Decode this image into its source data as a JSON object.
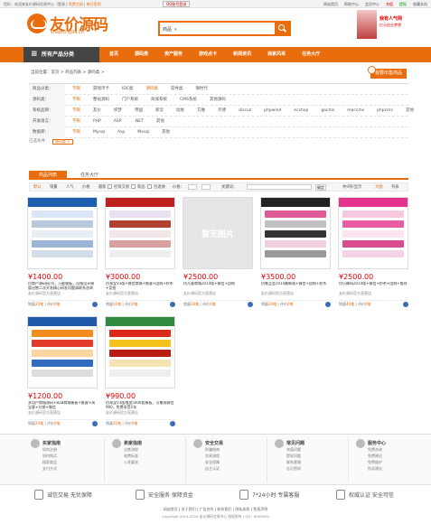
{
  "topbar": {
    "welcome": "您好，欢迎来友价源码交易中心（登录",
    "register": "免费注册",
    "sign": "每日签到",
    "qq": "QQ账号登录",
    "right": [
      "网站首页",
      "帮助中心",
      "会员中心",
      "充值",
      "提现",
      "收藏本站"
    ]
  },
  "logo": {
    "name": "友价源码",
    "domain": "shopt5.yj99.cn"
  },
  "search": {
    "category": "商品",
    "placeholder": ""
  },
  "ad": {
    "t1": "我有人气网",
    "t2": "亿元创业梦想"
  },
  "nav": {
    "allcat": "所有产品分类",
    "links": [
      "首页",
      "源码类",
      "资产服务",
      "游戏点卡",
      "新闻资讯",
      "商家风采",
      "任务大厅"
    ]
  },
  "crumb": "当前位置：首页 > 商品列表 > 源码类 >",
  "post_button": "我要出售商品",
  "filters": [
    {
      "label": "商品分类：",
      "options": [
        "不限",
        "游戏币卡",
        "IDC类",
        "源码类",
        "软件类",
        "微时代"
      ],
      "active": 3
    },
    {
      "label": "源码类：",
      "options": [
        "不限",
        "整站源码",
        "门户系统",
        "商城系统",
        "CMS系统",
        "其他源码"
      ],
      "active": 0
    },
    {
      "label": "系统品牌：",
      "options": [
        "不限",
        "友价",
        "织梦",
        "帝国",
        "新云",
        "动易",
        "方维",
        "齐博",
        "discuz",
        "phpwind",
        "ecshop",
        "gacms",
        "maccms",
        "phpcms",
        "其他"
      ],
      "active": 0
    },
    {
      "label": "开发语言：",
      "options": [
        "不限",
        "PHP",
        "ASP",
        ".NET",
        "其他"
      ],
      "active": 0
    },
    {
      "label": "数据库：",
      "options": [
        "不限",
        "Mysql",
        "Asp",
        "Mssql",
        "其他"
      ],
      "active": 0
    }
  ],
  "selected": {
    "label": "已选条件：",
    "tag": "源码类 ×"
  },
  "tabs": [
    "商品列表",
    "任务大厅"
  ],
  "sortbar": {
    "items": [
      "默认",
      "销量",
      "人气",
      "价格",
      "最新"
    ],
    "opts": [
      "担保交易",
      "新品",
      "包退换",
      "价格："
    ],
    "keyword": "关键词：",
    "ok": "确定",
    "pages": "共9项/显示",
    "view": "大图",
    "list": "列表"
  },
  "products": [
    {
      "price": "¥1400.00",
      "title": "仿商户源码网76，万能模板，风格设计模版出售二次开发精心研发问题请联系咨询",
      "shop": "友价源码官方直营店",
      "sales": "销量",
      "sales_n": "20笔",
      "reviews": "评价",
      "reviews_n": "0笔",
      "img": "blue"
    },
    {
      "price": "¥3000.00",
      "title": "仿淘宝V3版+微信商城+推客+团购+秒杀+竞拍",
      "shop": "友价源码官方直营店",
      "sales": "销量",
      "sales_n": "20笔",
      "reviews": "评价",
      "reviews_n": "0笔",
      "img": "v3"
    },
    {
      "price": "¥2500.00",
      "title": "仿凡客商城2014版+微信+团购",
      "shop": "友价源码官方直营店",
      "sales": "销量",
      "sales_n": "20笔",
      "reviews": "评价",
      "reviews_n": "0笔",
      "img": "none",
      "noimg": "暂无图片"
    },
    {
      "price": "¥3500.00",
      "title": "仿唯品会2014最新版+微信+团购+秒杀",
      "shop": "友价源码官方直营店",
      "sales": "销量",
      "sales_n": "20笔",
      "reviews": "评价",
      "reviews_n": "0笔",
      "img": "dark"
    },
    {
      "price": "¥2500.00",
      "title": "仿乐蜂网2014版+微信+秒杀+团购+推荐",
      "shop": "友价源码官方直营店",
      "sales": "销量",
      "sales_n": "40笔",
      "reviews": "评价",
      "reviews_n": "0笔",
      "img": "pink"
    },
    {
      "price": "¥1200.00",
      "title": "多用户商城源码+B2B商城模板+推客+淘宝客+分销+微信",
      "shop": "友价源码官方直营店",
      "sales": "销量",
      "sales_n": "20笔",
      "reviews": "评价",
      "reviews_n": "0笔",
      "img": "orange"
    },
    {
      "price": "¥990.00",
      "title": "仿淘宝V3版增加5000套模板，可集成微信990，免费享受1年",
      "shop": "友价源码官方直营店",
      "sales": "销量",
      "sales_n": "20笔",
      "reviews": "评价",
      "reviews_n": "0笔",
      "img": "red"
    }
  ],
  "help": [
    {
      "title": "买家指南",
      "links": [
        "如何注册",
        "如何购买",
        "搜索商品",
        "支付方式"
      ]
    },
    {
      "title": "卖家指南",
      "links": [
        "出售流程",
        "收费标准",
        "入驻要求"
      ]
    },
    {
      "title": "安全交易",
      "links": [
        "防骗指南",
        "交易流程",
        "安全保障",
        "店主认证"
      ]
    },
    {
      "title": "常见问题",
      "links": [
        "充值问题",
        "提现问题",
        "联系客服",
        "忘记密码"
      ]
    },
    {
      "title": "服务中心",
      "links": [
        "免费咨询",
        "免费建议",
        "免费维护",
        "投诉建议"
      ]
    }
  ],
  "guarantee": [
    "诚信交易 无忧保障",
    "安全服务 保障资金",
    "7*24小时 专属客服",
    "权威认证 安全可信"
  ],
  "footer": {
    "links": "网站首页 | 关于我们 | 广告合作 | 联系我们 | 隐私条款 | 免责声明",
    "copy": "Copyright 2014-2024 友价源码交易中心 版权所有 | QQ：8000000"
  }
}
